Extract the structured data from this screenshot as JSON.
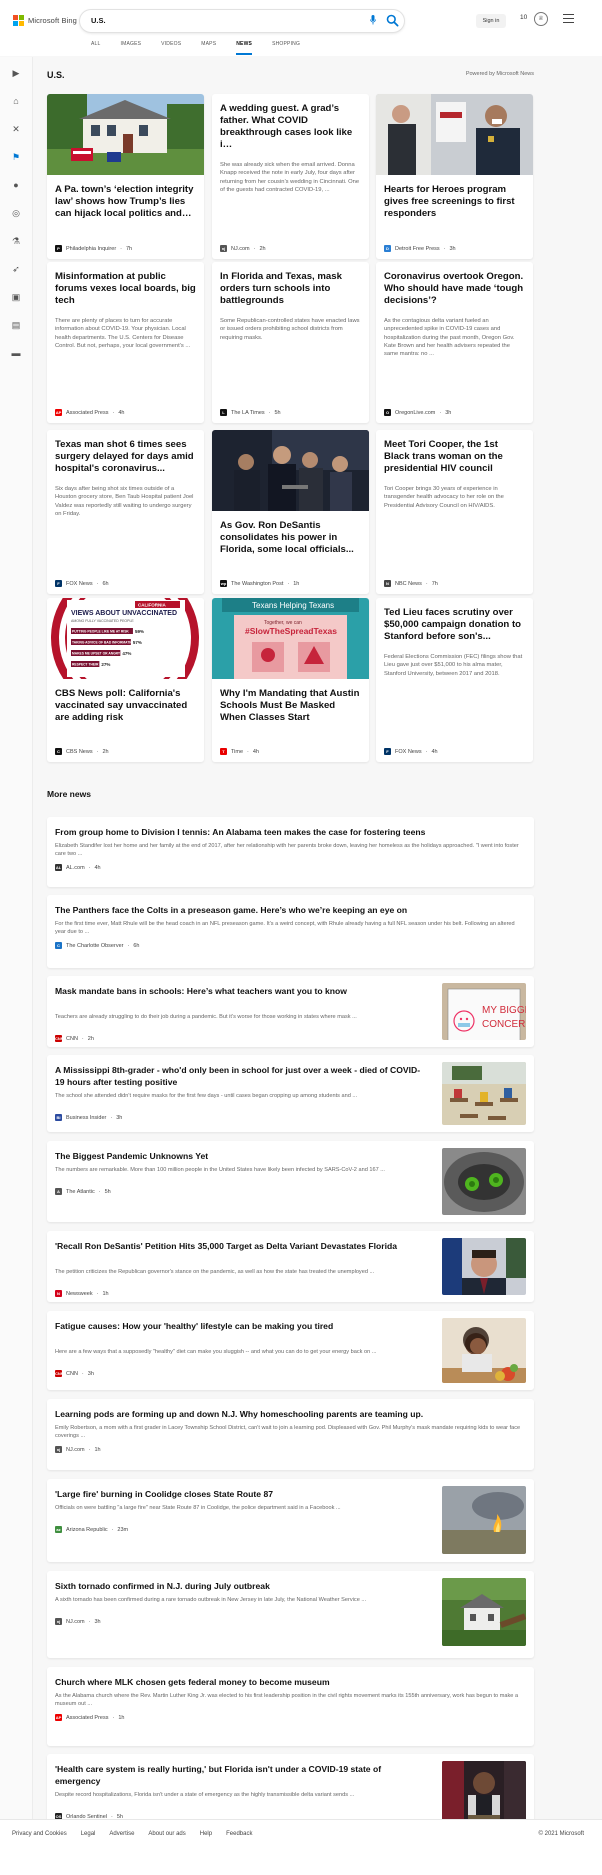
{
  "header": {
    "brand": "Microsoft Bing",
    "logo_colors": [
      "#f25022",
      "#7fba00",
      "#00a4ef",
      "#ffb900"
    ],
    "search_value": "U.S.",
    "signin_label": "Sign in",
    "rewards_count": "10",
    "icons": [
      "microphone-icon",
      "search-icon",
      "rewards-medal-icon",
      "menu-icon"
    ]
  },
  "tabs": [
    {
      "label": "ALL"
    },
    {
      "label": "IMAGES"
    },
    {
      "label": "VIDEOS"
    },
    {
      "label": "MAPS"
    },
    {
      "label": "NEWS",
      "active": true
    },
    {
      "label": "SHOPPING"
    }
  ],
  "sidebar_icons": [
    "expand-icon",
    "home-icon",
    "sports-icon",
    "flag-icon",
    "pin-icon",
    "globe-icon",
    "science-icon",
    "rocket-icon",
    "entertainment-icon",
    "briefcase-icon",
    "money-icon"
  ],
  "page": {
    "title": "U.S.",
    "powered": "Powered by Microsoft News"
  },
  "cards": [
    {
      "title": "A Pa. town’s ‘election integrity law’ shows how Trump’s lies can hijack local politics and…",
      "snippet": "",
      "source": "Philadelphia Inquirer",
      "time": "7h",
      "badge": "P",
      "badge_color": "#111",
      "has_image": true
    },
    {
      "title": "A wedding guest. A grad’s father. What COVID breakthrough cases look like i…",
      "snippet": "She was already sick when the email arrived. Donna Knapp received the note in early July, four days after returning from her cousin’s wedding in Cincinnati. One of the guests had contracted COVID-19, ...",
      "source": "NJ.com",
      "time": "2h",
      "badge": "nj",
      "badge_color": "#555",
      "has_image": false
    },
    {
      "title": "Hearts for Heroes program gives free screenings to first responders",
      "snippet": "",
      "source": "Detroit Free Press",
      "time": "3h",
      "badge": "D",
      "badge_color": "#2a7fd4",
      "has_image": true
    },
    {
      "title": "Misinformation at public forums vexes local boards, big tech",
      "snippet": "There are plenty of places to turn for accurate information about COVID-19. Your physician. Local health departments. The U.S. Centers for Disease Control. But not, perhaps, your local government’s ...",
      "source": "Associated Press",
      "time": "4h",
      "badge": "AP",
      "badge_color": "#e00",
      "has_image": false
    },
    {
      "title": "In Florida and Texas, mask orders turn schools into battlegrounds",
      "snippet": "Some Republican-controlled states have enacted laws or issued orders prohibiting school districts from requiring masks.",
      "source": "The LA Times",
      "time": "5h",
      "badge": "L",
      "badge_color": "#111",
      "has_image": false
    },
    {
      "title": "Coronavirus overtook Oregon. Who should have made ‘tough decisions’?",
      "snippet": "As the contagious delta variant fueled an unprecedented spike in COVID-19 cases and hospitalization during the past month, Oregon Gov. Kate Brown and her health advisers repeated the same mantra: no ...",
      "source": "OregonLive.com",
      "time": "3h",
      "badge": "O",
      "badge_color": "#111",
      "has_image": false
    },
    {
      "title": "Texas man shot 6 times sees surgery delayed for days amid hospital's coronavirus...",
      "snippet": "Six days after being shot six times outside of a Houston grocery store, Ben Taub Hospital patient Joel Valdez was reportedly still waiting to undergo surgery on Friday.",
      "source": "FOX News",
      "time": "6h",
      "badge": "F",
      "badge_color": "#003366",
      "has_image": false
    },
    {
      "title": "As Gov. Ron DeSantis consolidates his power in Florida, some local officials...",
      "snippet": "",
      "source": "The Washington Post",
      "time": "1h",
      "badge": "wp",
      "badge_color": "#111",
      "has_image": true
    },
    {
      "title": "Meet Tori Cooper, the 1st Black trans woman on the presidential HIV council",
      "snippet": "Tori Cooper brings 30 years of experience in transgender health advocacy to her role on the Presidential Advisory Council on HIV/AIDS.",
      "source": "NBC News",
      "time": "7h",
      "badge": "N",
      "badge_color": "#444",
      "has_image": false
    },
    {
      "title": "CBS News poll: California's vaccinated say unvaccinated are adding risk",
      "snippet": "",
      "source": "CBS News",
      "time": "2h",
      "badge": "C",
      "badge_color": "#111",
      "has_image": true
    },
    {
      "title": "Why I'm Mandating that Austin Schools Must Be Masked When Classes Start",
      "snippet": "",
      "source": "Time",
      "time": "4h",
      "badge": "T",
      "badge_color": "#e90000",
      "has_image": true
    },
    {
      "title": "Ted Lieu faces scrutiny over $50,000 campaign donation to Stanford before son's...",
      "snippet": "Federal Elections Commission (FEC) filings show that Lieu gave just over $51,000 to his alma mater, Stanford University, between 2017 and 2018.",
      "source": "FOX News",
      "time": "4h",
      "badge": "F",
      "badge_color": "#003366",
      "has_image": false
    }
  ],
  "cbs_graphic": {
    "tag": "CALIFORNIA",
    "heading": "VIEWS ABOUT UNVACCINATED",
    "sub": "AMONG FULLY VACCINATED PEOPLE",
    "rows": [
      {
        "label": "PUTTING PEOPLE LIKE ME AT RISK",
        "pct": "59%"
      },
      {
        "label": "TAKING ADVICE OF BAD INFORMATION",
        "pct": "57%"
      },
      {
        "label": "MAKES ME UPSET OR ANGRY",
        "pct": "47%"
      },
      {
        "label": "RESPECT THEIR DECISION",
        "pct": "27%"
      }
    ]
  },
  "time_graphic": {
    "banner": "Texans Helping Texans",
    "line1": "Together, we can",
    "hashtag": "#SlowTheSpreadTexas"
  },
  "more": {
    "heading": "More news",
    "items": [
      {
        "title": "From group home to Division I tennis: An Alabama teen makes the case for fostering teens",
        "snippet": "Elizabeth Standifer lost her home and her family at the end of 2017, after her relationship with her parents broke down, leaving her homeless as the holidays approached. \"I went into foster care two ...",
        "source": "AL.com",
        "time": "4h",
        "badge": "AL",
        "badge_color": "#333",
        "thumb": null
      },
      {
        "title": "The Panthers face the Colts in a preseason game. Here’s who we’re keeping an eye on",
        "snippet": "For the first time ever, Matt Rhule will be the head coach in an NFL preseason game. It’s a weird concept, with Rhule already having a full NFL season under his belt. Following an altered year due to ...",
        "source": "The Charlotte Observer",
        "time": "6h",
        "badge": "C",
        "badge_color": "#1a73c7",
        "thumb": null
      },
      {
        "title": "Mask mandate bans in schools: Here’s what teachers want you to know",
        "snippet": "Teachers are already struggling to do their job during a pandemic. But it’s worse for those working in states where mask ...",
        "source": "CNN",
        "time": "2h",
        "badge": "CNN",
        "badge_color": "#cc0000",
        "thumb": "sign",
        "sign_text": "MY BIGGEST CONCERN"
      },
      {
        "title": "A Mississippi 8th-grader - who'd only been in school for just over a week - died of COVID-19 hours after testing positive",
        "snippet": "The school she attended didn't require masks for the first few days - until cases began cropping up among students and ...",
        "source": "Business Insider",
        "time": "3h",
        "badge": "BI",
        "badge_color": "#2b4ba0",
        "thumb": "classroom"
      },
      {
        "title": "The Biggest Pandemic Unknowns Yet",
        "snippet": "The numbers are remarkable. More than 100 million people in the United States have likely been infected by SARS-CoV-2 and 167 ...",
        "source": "The Atlantic",
        "time": "5h",
        "badge": "A",
        "badge_color": "#555",
        "thumb": "virus"
      },
      {
        "title": "'Recall Ron DeSantis' Petition Hits 35,000 Target as Delta Variant Devastates Florida",
        "snippet": "The petition criticizes the Republican governor's stance on the pandemic, as well as how the state has treated the unemployed ...",
        "source": "Newsweek",
        "time": "1h",
        "badge": "N",
        "badge_color": "#d4001a",
        "thumb": "desantis"
      },
      {
        "title": "Fatigue causes: How your 'healthy' lifestyle can be making you tired",
        "snippet": "Here are a few ways that a supposedly \"healthy\" diet can make you sluggish -- and what you can do to get your energy back on ...",
        "source": "CNN",
        "time": "3h",
        "badge": "CNN",
        "badge_color": "#cc0000",
        "thumb": "woman"
      },
      {
        "title": "Learning pods are forming up and down N.J. Why homeschooling parents are teaming up.",
        "snippet": "Emily Robertson, a mom with a first grader in Lacey Township School District, can't wait to join a learning pod. Displeased with Gov. Phil Murphy's mask mandate requiring kids to wear face coverings ...",
        "source": "NJ.com",
        "time": "1h",
        "badge": "nj",
        "badge_color": "#555",
        "thumb": null
      },
      {
        "title": "'Large fire' burning in Coolidge closes State Route 87",
        "snippet": "Officials on were battling \"a large fire\" near State Route 87 in Coolidge, the police department said in a Facebook ...",
        "source": "Arizona Republic",
        "time": "23m",
        "badge": "az",
        "badge_color": "#3f8f3f",
        "thumb": "fire"
      },
      {
        "title": "Sixth tornado confirmed in N.J. during July outbreak",
        "snippet": "A sixth tornado has been confirmed during a rare tornado outbreak in New Jersey in late July, the National Weather Service ...",
        "source": "NJ.com",
        "time": "3h",
        "badge": "nj",
        "badge_color": "#555",
        "thumb": "tornado"
      },
      {
        "title": "Church where MLK chosen gets federal money to become museum",
        "snippet": "As the Alabama church where the Rev. Martin Luther King Jr. was elected to his first leadership position in the civil rights movement marks its 155th anniversary, work has begun to make a museum out ...",
        "source": "Associated Press",
        "time": "1h",
        "badge": "AP",
        "badge_color": "#e00",
        "thumb": null
      },
      {
        "title": "'Health care system is really hurting,' but Florida isn't under a COVID-19 state of emergency",
        "snippet": "Despite record hospitalizations, Florida isn't under a state of emergency as the highly transmissible delta variant sends ...",
        "source": "Orlando Sentinel",
        "time": "5h",
        "badge": "OS",
        "badge_color": "#222",
        "thumb": "speaker"
      }
    ]
  },
  "footer": {
    "links": [
      "Privacy and Cookies",
      "Legal",
      "Advertise",
      "About our ads",
      "Help",
      "Feedback"
    ],
    "copyright": "© 2021 Microsoft"
  }
}
